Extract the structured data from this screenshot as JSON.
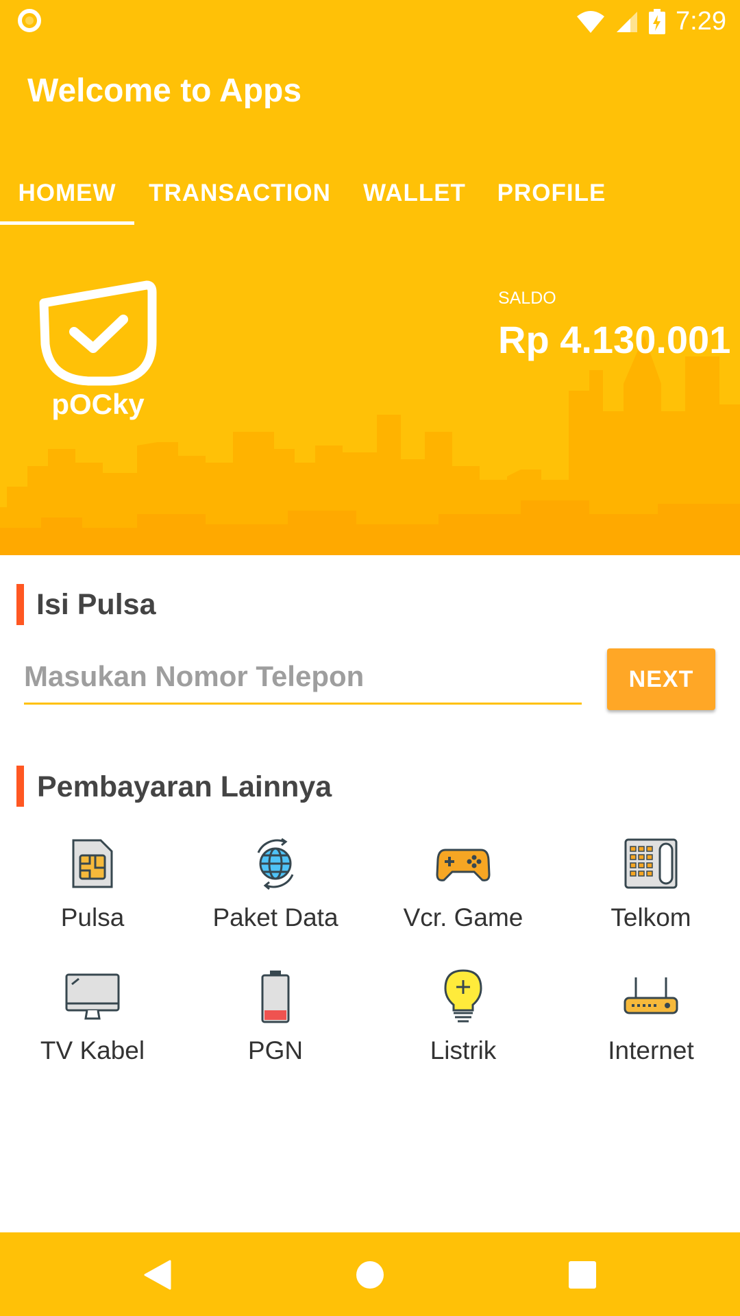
{
  "status": {
    "time": "7:29"
  },
  "app": {
    "title": "Welcome to Apps"
  },
  "tabs": [
    {
      "label": "HOMEW",
      "active": true
    },
    {
      "label": "TRANSACTION",
      "active": false
    },
    {
      "label": "WALLET",
      "active": false
    },
    {
      "label": "PROFILE",
      "active": false
    }
  ],
  "hero": {
    "logo_text": "pOCky",
    "saldo_label": "SALDO",
    "saldo_value": "Rp 4.130.001"
  },
  "isi_pulsa": {
    "title": "Isi Pulsa",
    "placeholder": "Masukan Nomor Telepon",
    "value": "",
    "next_label": "NEXT"
  },
  "pembayaran": {
    "title": "Pembayaran Lainnya",
    "items": [
      {
        "label": "Pulsa",
        "icon": "sim-card-icon"
      },
      {
        "label": "Paket Data",
        "icon": "globe-sync-icon"
      },
      {
        "label": "Vcr. Game",
        "icon": "gamepad-icon"
      },
      {
        "label": "Telkom",
        "icon": "telephone-icon"
      },
      {
        "label": "TV Kabel",
        "icon": "monitor-icon"
      },
      {
        "label": "PGN",
        "icon": "battery-icon"
      },
      {
        "label": "Listrik",
        "icon": "lightbulb-icon"
      },
      {
        "label": "Internet",
        "icon": "router-icon"
      }
    ]
  },
  "colors": {
    "primary": "#FFC107",
    "accent": "#FFA726",
    "section_bar": "#FF5722"
  }
}
